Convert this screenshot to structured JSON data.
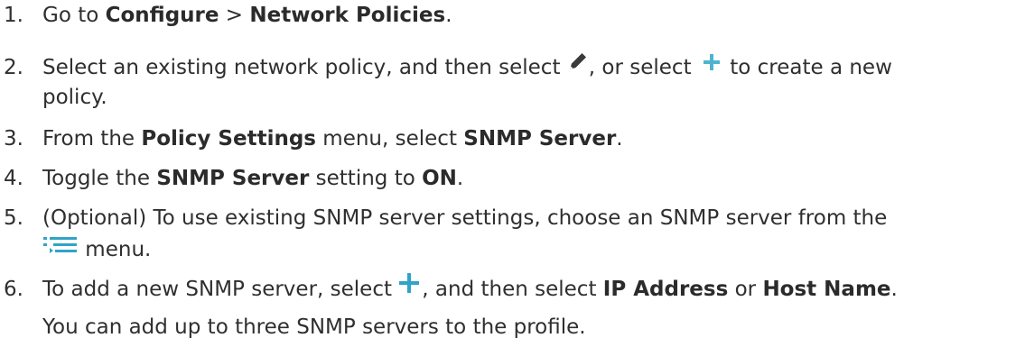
{
  "steps": [
    {
      "number": "1.",
      "text_1": "Go to ",
      "bold_1": "Configure",
      "text_2": " > ",
      "bold_2": "Network Policies",
      "text_3": "."
    },
    {
      "number": "2.",
      "text_1": "Select an existing network policy, and then select ",
      "icon_1": "pencil-icon",
      "text_2": ", or select ",
      "icon_2": "plus-icon",
      "text_3": " to create a new",
      "text_4": "policy."
    },
    {
      "number": "3.",
      "text_1": "From the ",
      "bold_1": "Policy Settings",
      "text_2": " menu, select ",
      "bold_2": "SNMP Server",
      "text_3": "."
    },
    {
      "number": "4.",
      "text_1": "Toggle the ",
      "bold_1": "SNMP Server",
      "text_2": " setting to ",
      "bold_2": "ON",
      "text_3": "."
    },
    {
      "number": "5.",
      "text_1": "(Optional) To use existing SNMP server settings, choose an SNMP server from the",
      "icon_1": "list-menu-icon",
      "text_2": " menu."
    },
    {
      "number": "6.",
      "text_1": "To add a new SNMP server, select ",
      "icon_1": "plus-icon",
      "text_2": ", and then select ",
      "bold_1": "IP Address",
      "text_3": " or ",
      "bold_2": "Host Name",
      "text_4": ".",
      "text_5": "You can add up to three SNMP servers to the profile."
    }
  ],
  "colors": {
    "text": "#2f2f2f",
    "pencil": "#3a3a3a",
    "plus": "#4fb3cf",
    "menu": "#2fa4c8"
  }
}
